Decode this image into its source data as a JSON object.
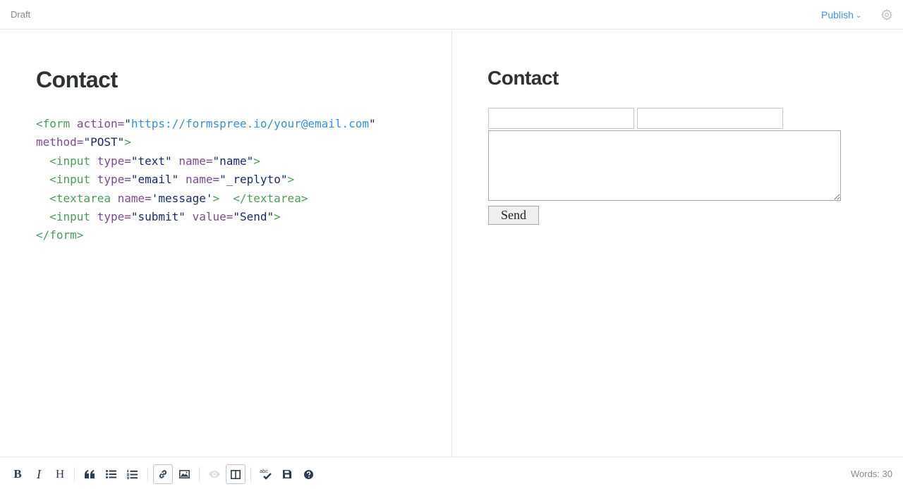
{
  "header": {
    "status": "Draft",
    "publish_label": "Publish"
  },
  "editor": {
    "heading": "Contact",
    "code": {
      "line1": {
        "open": "<form",
        "attr1": "action=",
        "str1": "\"",
        "url": "https://formspree.io/your@email.com",
        "str1_end": "\""
      },
      "line2": {
        "attr": "method=",
        "str": "\"POST\"",
        "close": ">"
      },
      "line3": {
        "open": "  <input",
        "attr1": "type=",
        "str1": "\"text\"",
        "attr2": "name=",
        "str2": "\"name\"",
        "close": ">"
      },
      "line4": {
        "open": "  <input",
        "attr1": "type=",
        "str1": "\"email\"",
        "attr2": "name=",
        "str2": "\"_replyto\"",
        "close": ">"
      },
      "line5": {
        "open": "  <textarea",
        "attr1": "name=",
        "str1": "'message'",
        "close": ">  </textarea>"
      },
      "line6": {
        "open": "  <input",
        "attr1": "type=",
        "str1": "\"submit\"",
        "attr2": "value=",
        "str2": "\"Send\"",
        "close": ">"
      },
      "line7": {
        "close": "</form>"
      }
    }
  },
  "preview": {
    "heading": "Contact",
    "name_value": "",
    "email_value": "",
    "message_value": "",
    "submit_label": "Send"
  },
  "toolbar": {
    "bold": "B",
    "italic": "I",
    "heading": "H",
    "words_label": "Words: 30",
    "spellcheck_abc": "abc",
    "icons": [
      "bold-icon",
      "italic-icon",
      "heading-icon",
      "quote-icon",
      "unordered-list-icon",
      "ordered-list-icon",
      "link-icon",
      "image-icon",
      "preview-eye-icon",
      "side-by-side-icon",
      "spellcheck-icon",
      "save-icon",
      "help-icon"
    ]
  },
  "colors": {
    "accent": "#4a90d9",
    "tag": "#4e9a5c",
    "attr": "#7a4d8c",
    "string": "#1a2a6c",
    "url": "#3b8ed8"
  }
}
